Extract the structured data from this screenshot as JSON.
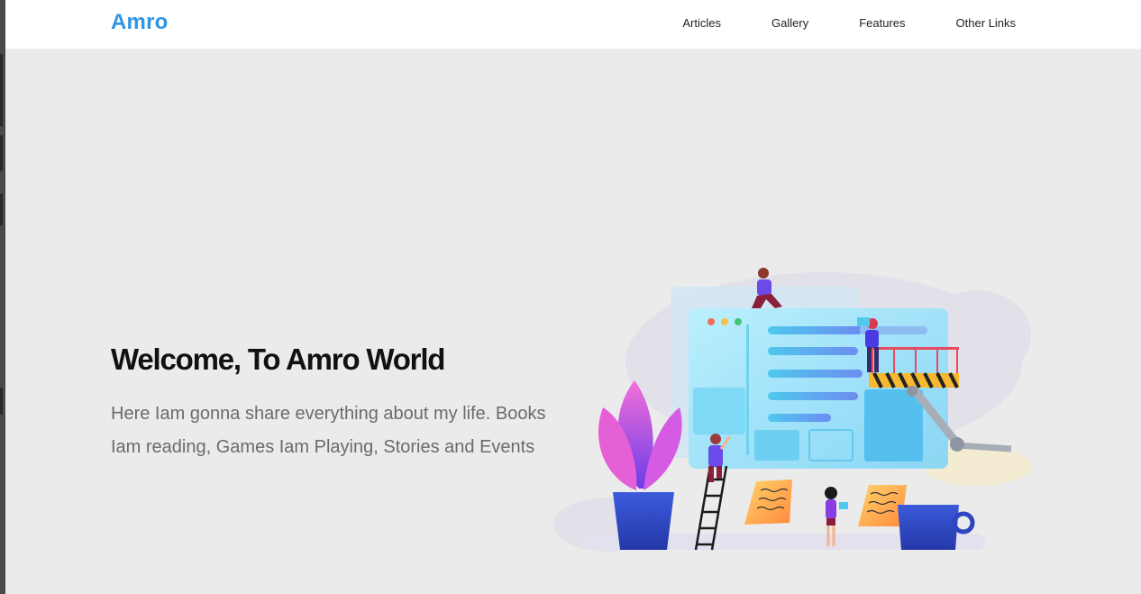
{
  "nav": {
    "logo": "Amro",
    "links": [
      "Articles",
      "Gallery",
      "Features",
      "Other Links"
    ]
  },
  "hero": {
    "title": "Welcome, To Amro World",
    "description": "Here Iam gonna share everything about my life. Books Iam reading, Games Iam Playing, Stories and Events"
  },
  "colors": {
    "brand": "#2e94e4",
    "background": "#ebebeb",
    "navbar": "#ffffff",
    "title": "#111111",
    "body_text": "#6b6b6b"
  }
}
